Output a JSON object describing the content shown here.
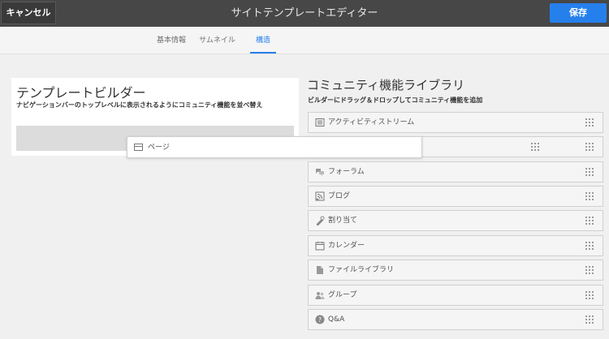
{
  "header": {
    "cancel_label": "キャンセル",
    "title": "サイトテンプレートエディター",
    "save_label": "保存"
  },
  "tabs": [
    {
      "label": "基本情報",
      "active": false
    },
    {
      "label": "サムネイル",
      "active": false
    },
    {
      "label": "構造",
      "active": true
    }
  ],
  "builder": {
    "title": "テンプレートビルダー",
    "description": "ナビゲーションバーのトップレベルに表示されるようにコミュニティ機能を並べ替え",
    "dragged_item": {
      "label": "ページ",
      "icon": "page-icon"
    }
  },
  "library": {
    "title": "コミュニティ機能ライブラリ",
    "description": "ビルダーにドラッグ＆ドロップしてコミュニティ機能を追加",
    "items": [
      {
        "label": "アクティビティストリーム",
        "icon": "activity-stream-icon"
      },
      {
        "label": "",
        "icon": "hidden-item-icon"
      },
      {
        "label": "フォーラム",
        "icon": "forum-icon"
      },
      {
        "label": "ブログ",
        "icon": "blog-icon"
      },
      {
        "label": "割り当て",
        "icon": "assignment-icon"
      },
      {
        "label": "カレンダー",
        "icon": "calendar-icon"
      },
      {
        "label": "ファイルライブラリ",
        "icon": "file-library-icon"
      },
      {
        "label": "グループ",
        "icon": "group-icon"
      },
      {
        "label": "Q&A",
        "icon": "qna-icon"
      }
    ]
  },
  "colors": {
    "accent": "#2680eb",
    "header_bg": "#474747"
  }
}
